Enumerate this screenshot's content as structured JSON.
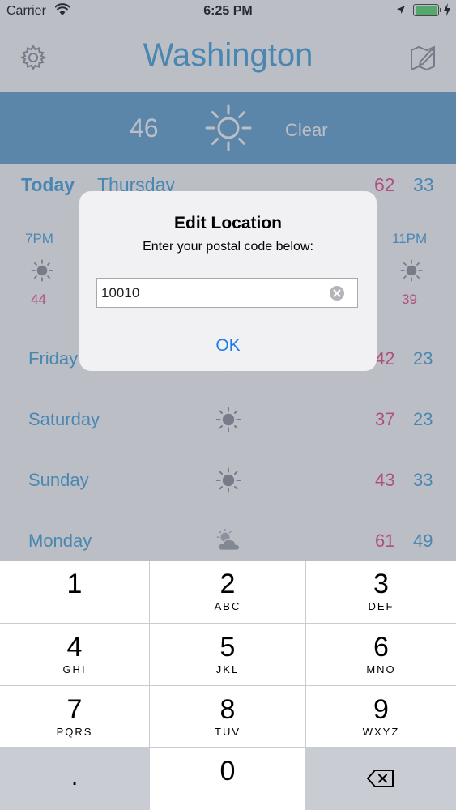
{
  "status_bar": {
    "carrier": "Carrier",
    "time": "6:25 PM"
  },
  "header": {
    "city": "Washington"
  },
  "current": {
    "temp": "46",
    "condition": "Clear"
  },
  "today": {
    "label": "Today",
    "weekday": "Thursday",
    "hi": "62",
    "lo": "33",
    "hours": [
      {
        "time": "7PM",
        "temp": "44",
        "icon": "sun-icon"
      },
      {
        "time": "11PM",
        "temp": "39",
        "icon": "sun-icon"
      }
    ]
  },
  "forecast": [
    {
      "day": "Friday",
      "hi": "42",
      "lo": "23",
      "icon": "sun-icon"
    },
    {
      "day": "Saturday",
      "hi": "37",
      "lo": "23",
      "icon": "sun-icon"
    },
    {
      "day": "Sunday",
      "hi": "43",
      "lo": "33",
      "icon": "sun-icon"
    },
    {
      "day": "Monday",
      "hi": "61",
      "lo": "49",
      "icon": "partly-cloudy-icon"
    }
  ],
  "alert": {
    "title": "Edit Location",
    "message": "Enter your postal code below:",
    "value": "10010",
    "ok": "OK"
  },
  "keypad": {
    "keys": [
      {
        "num": "1",
        "letters": ""
      },
      {
        "num": "2",
        "letters": "ABC"
      },
      {
        "num": "3",
        "letters": "DEF"
      },
      {
        "num": "4",
        "letters": "GHI"
      },
      {
        "num": "5",
        "letters": "JKL"
      },
      {
        "num": "6",
        "letters": "MNO"
      },
      {
        "num": "7",
        "letters": "PQRS"
      },
      {
        "num": "8",
        "letters": "TUV"
      },
      {
        "num": "9",
        "letters": "WXYZ"
      },
      {
        "num": "0",
        "letters": ""
      }
    ],
    "decimal": "."
  },
  "colors": {
    "accent": "#3aa0dc",
    "high_temp": "#e8457a",
    "band": "#5a9fce",
    "ok_button": "#1a7ee8",
    "battery": "#4cd964"
  }
}
